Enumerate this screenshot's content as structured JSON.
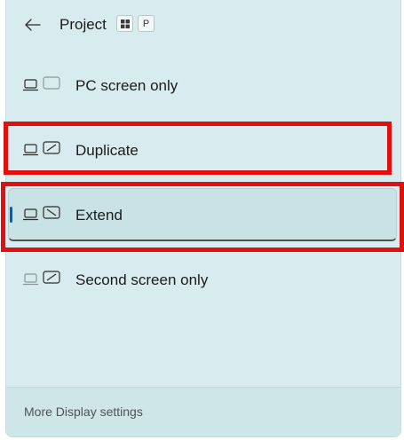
{
  "header": {
    "title": "Project",
    "shortcut_key_1": "win-key-icon",
    "shortcut_key_2": "P"
  },
  "options": [
    {
      "label": "PC screen only",
      "icon": "pc-screen-only-icon",
      "selected": false,
      "highlighted": false
    },
    {
      "label": "Duplicate",
      "icon": "duplicate-icon",
      "selected": false,
      "highlighted": true
    },
    {
      "label": "Extend",
      "icon": "extend-icon",
      "selected": true,
      "highlighted": true
    },
    {
      "label": "Second screen only",
      "icon": "second-screen-only-icon",
      "selected": false,
      "highlighted": false
    }
  ],
  "footer": {
    "link": "More Display settings"
  },
  "colors": {
    "background": "#d8ecef",
    "selected_background": "#c9e2e5",
    "accent": "#005fb8",
    "highlight_box": "#e01010"
  }
}
